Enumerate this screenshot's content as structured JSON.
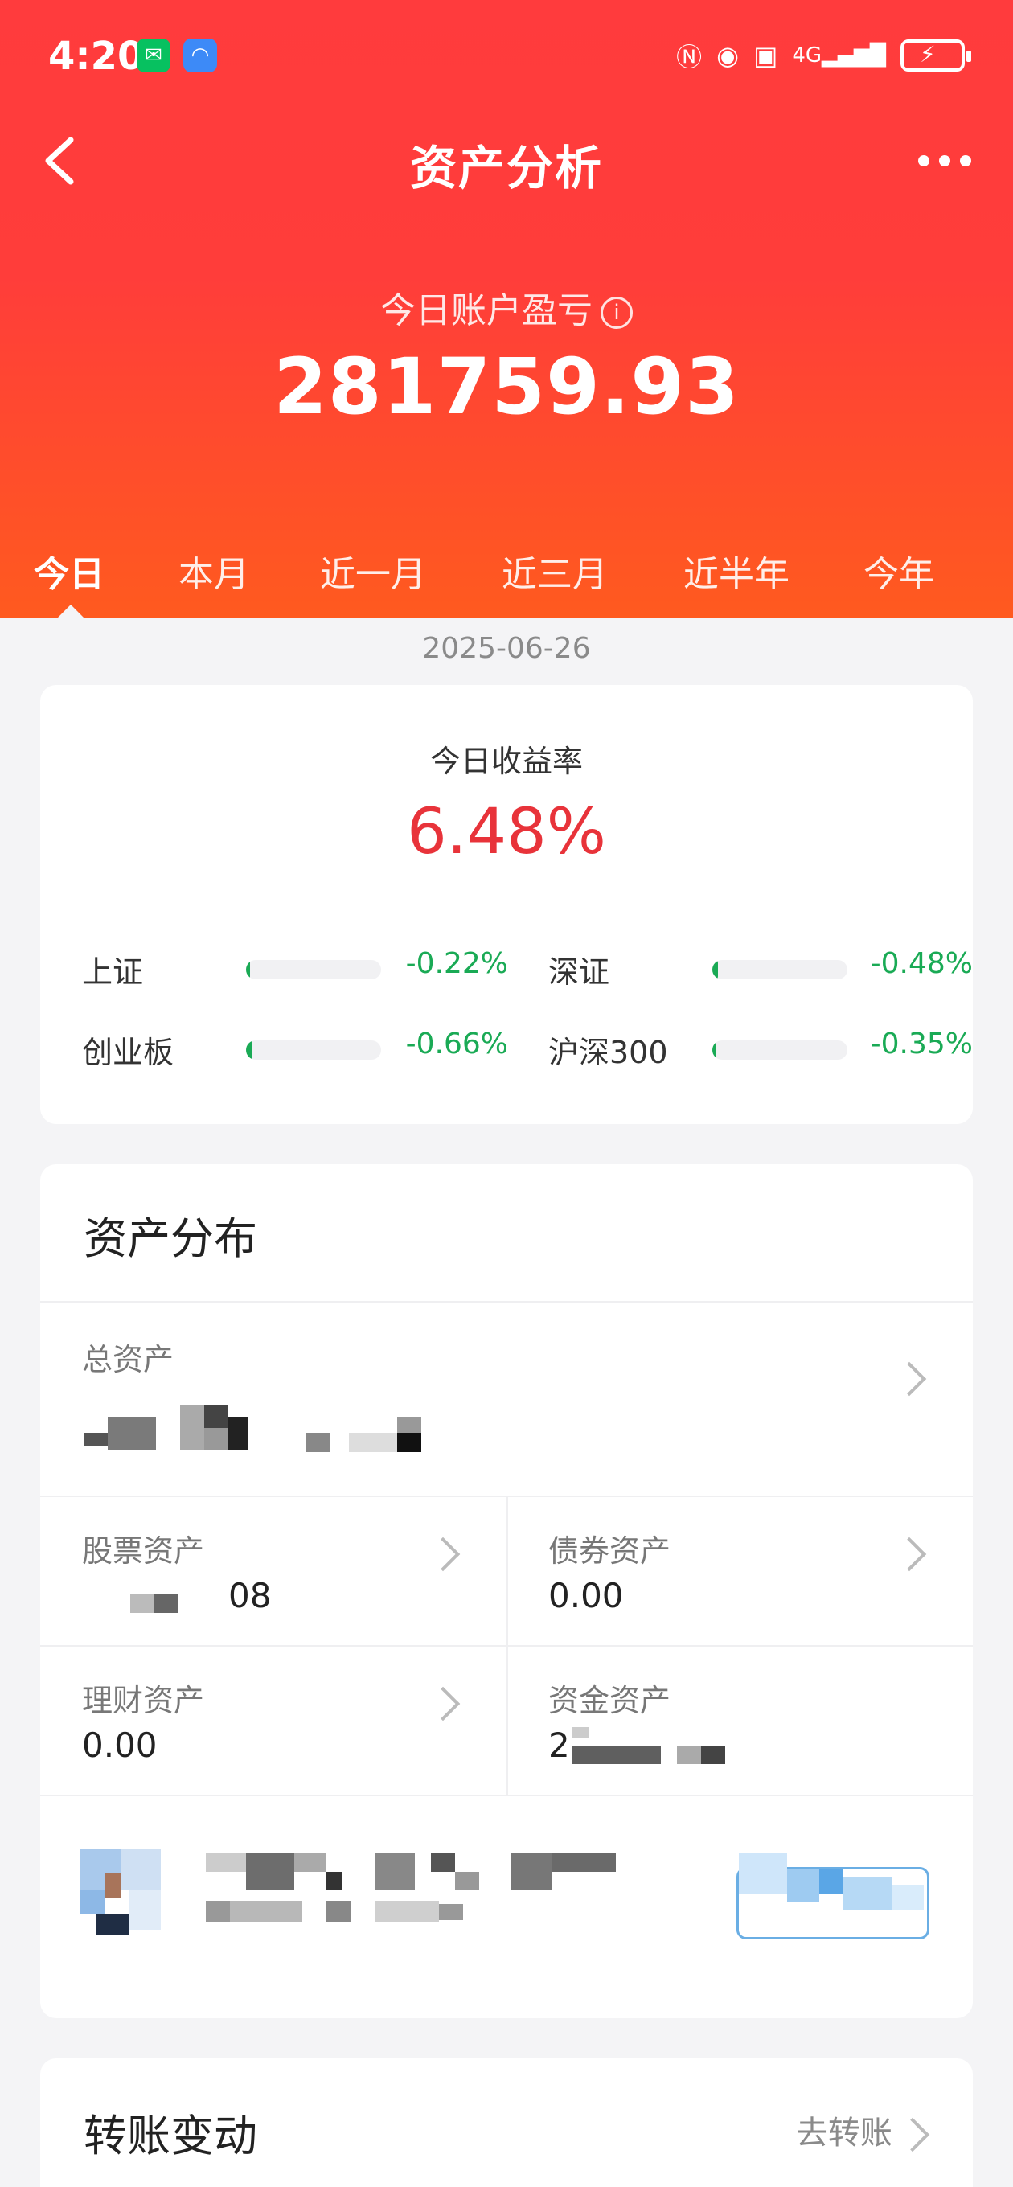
{
  "status_bar": {
    "time": "4:20",
    "icons": [
      "wechat-icon",
      "wifi-app-icon",
      "nfc-icon",
      "eye-icon",
      "signal-4g-icon",
      "battery-charging-icon"
    ],
    "network": "4G"
  },
  "nav": {
    "title": "资产分析",
    "back_icon": "chevron-left-icon",
    "more_icon": "more-horizontal-icon"
  },
  "summary": {
    "label": "今日账户盈亏",
    "info_icon": "i",
    "value": "281759.93"
  },
  "tabs": [
    {
      "label": "今日",
      "active": true
    },
    {
      "label": "本月",
      "active": false
    },
    {
      "label": "近一月",
      "active": false
    },
    {
      "label": "近三月",
      "active": false
    },
    {
      "label": "近半年",
      "active": false
    },
    {
      "label": "今年",
      "active": false
    }
  ],
  "date": "2025-06-26",
  "returns": {
    "label": "今日收益率",
    "value": "6.48%",
    "indices": [
      {
        "name": "上证",
        "value": "-0.22%",
        "bar_fraction": 0.03
      },
      {
        "name": "深证",
        "value": "-0.48%",
        "bar_fraction": 0.04
      },
      {
        "name": "创业板",
        "value": "-0.66%",
        "bar_fraction": 0.05
      },
      {
        "name": "沪深300",
        "value": "-0.35%",
        "bar_fraction": 0.03
      }
    ]
  },
  "assets": {
    "title": "资产分布",
    "total_label": "总资产",
    "stock_label": "股票资产",
    "stock_value_tail": "08",
    "bond_label": "债券资产",
    "bond_value": "0.00",
    "wealth_label": "理财资产",
    "wealth_value": "0.00",
    "cash_label": "资金资产",
    "cash_value_head": "2"
  },
  "transfer": {
    "title": "转账变动",
    "link": "去转账"
  },
  "colors": {
    "header_top": "#ff3b3d",
    "header_bottom": "#ff5a1f",
    "gain": "#e8333a",
    "loss": "#1aaa55"
  }
}
